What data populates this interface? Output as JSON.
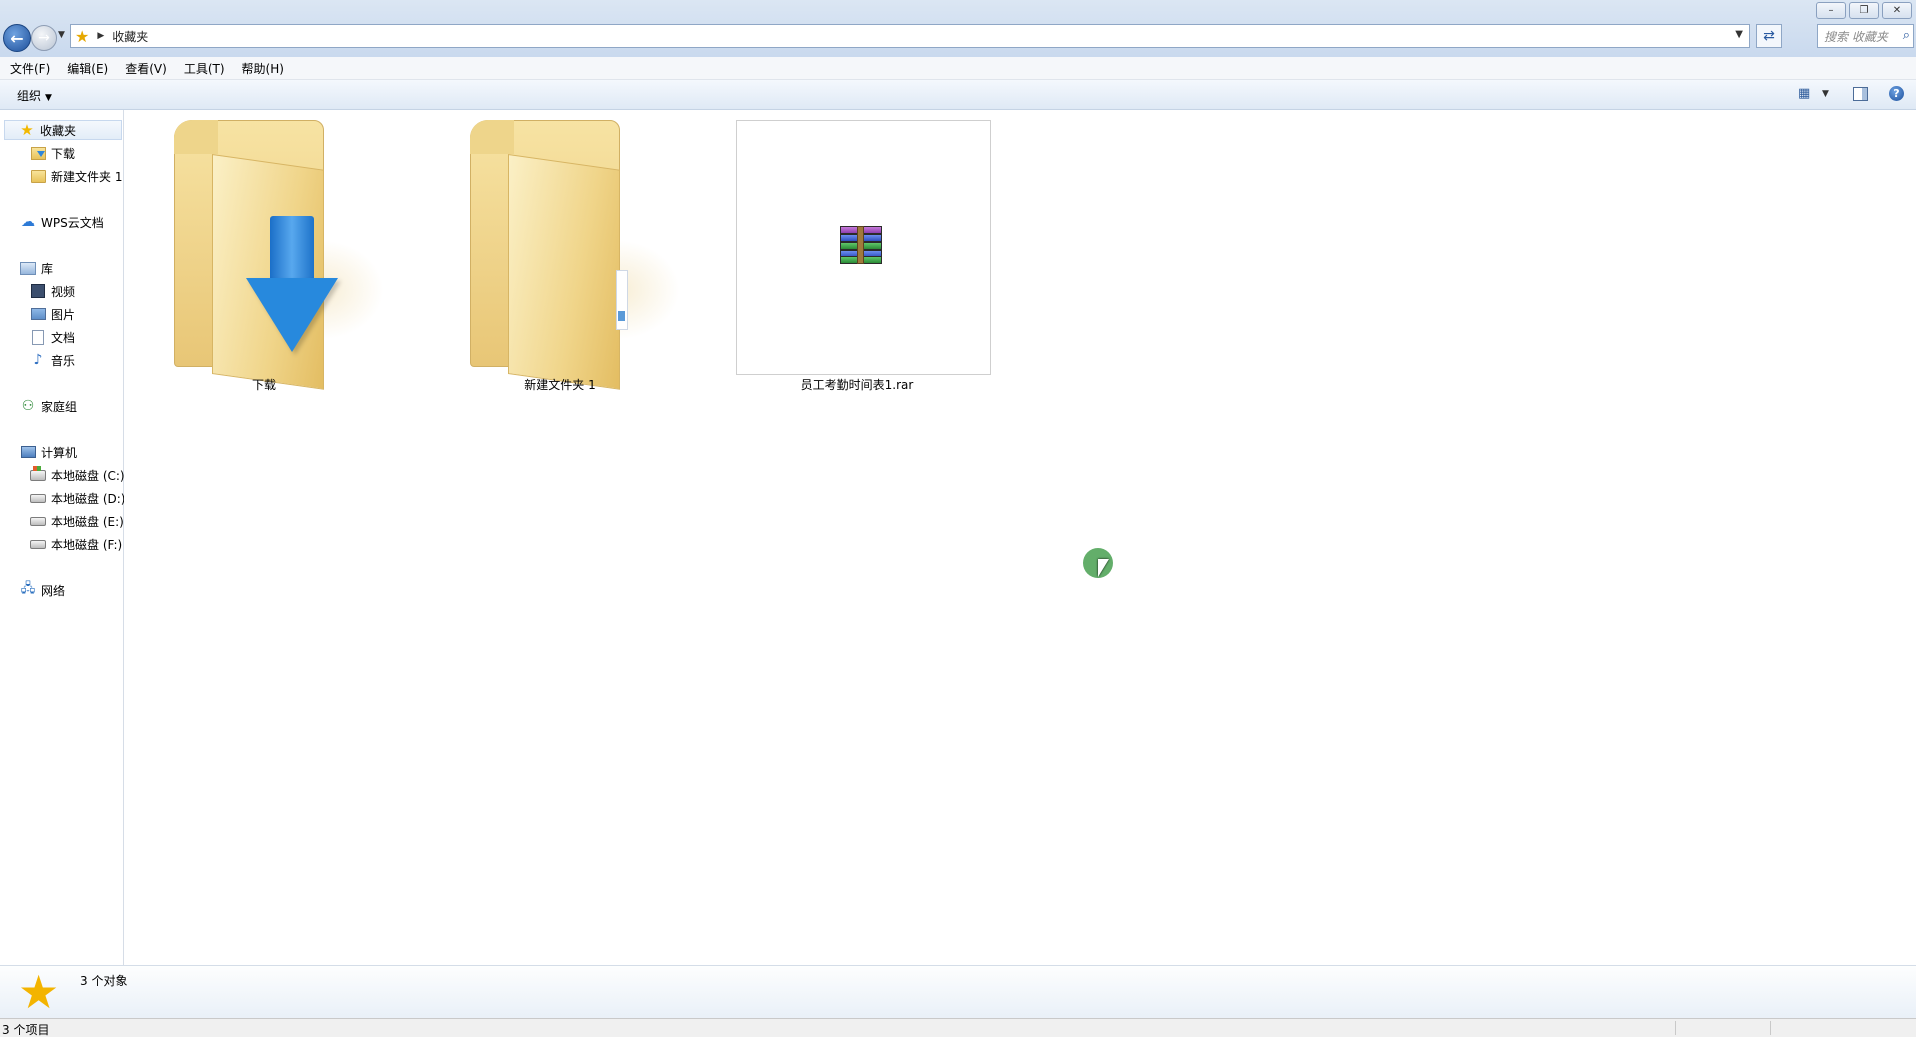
{
  "window": {
    "controls": [
      "–",
      "❐",
      "✕"
    ]
  },
  "address": {
    "path": "收藏夹",
    "search_placeholder": "搜索 收藏夹"
  },
  "menu": [
    "文件(F)",
    "编辑(E)",
    "查看(V)",
    "工具(T)",
    "帮助(H)"
  ],
  "toolbar": {
    "organize": "组织"
  },
  "navpane": {
    "favorites": "收藏夹",
    "downloads": "下载",
    "new_folder": "新建文件夹 1",
    "wps": "WPS云文档",
    "library": "库",
    "videos": "视频",
    "pictures": "图片",
    "documents": "文档",
    "music": "音乐",
    "homegroup": "家庭组",
    "computer": "计算机",
    "drive_c": "本地磁盘 (C:)",
    "drive_d": "本地磁盘 (D:)",
    "drive_e": "本地磁盘 (E:)",
    "drive_f": "本地磁盘 (F:)",
    "network": "网络"
  },
  "items": [
    {
      "name": "下载",
      "type": "download-folder"
    },
    {
      "name": "新建文件夹 1",
      "type": "folder"
    },
    {
      "name": "员工考勤时间表1.rar",
      "type": "rar-archive"
    }
  ],
  "details": {
    "count": "3 个对象"
  },
  "status": {
    "text": "3 个项目"
  },
  "colors": {
    "accent": "#2a5aa0",
    "favorite_star": "#f3b400",
    "folder": "#e8c676",
    "cursor_highlight": "#48a050"
  }
}
